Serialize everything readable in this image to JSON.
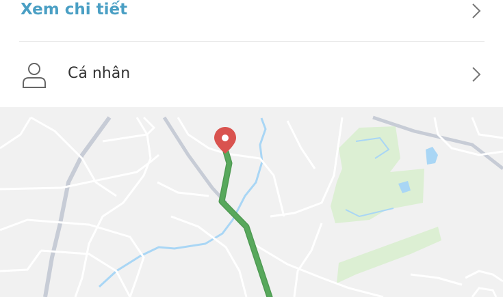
{
  "details_row": {
    "label": "Xem chi tiết"
  },
  "personal_row": {
    "label": "Cá nhân"
  },
  "colors": {
    "link": "#4a9fc4",
    "route": "#58a85c",
    "pin": "#d9534f",
    "park": "#dcefd3",
    "water": "#a9d6f5",
    "map_bg": "#f1f1f1"
  },
  "icons": [
    "chevron-right-icon",
    "person-icon",
    "location-pin-icon"
  ]
}
